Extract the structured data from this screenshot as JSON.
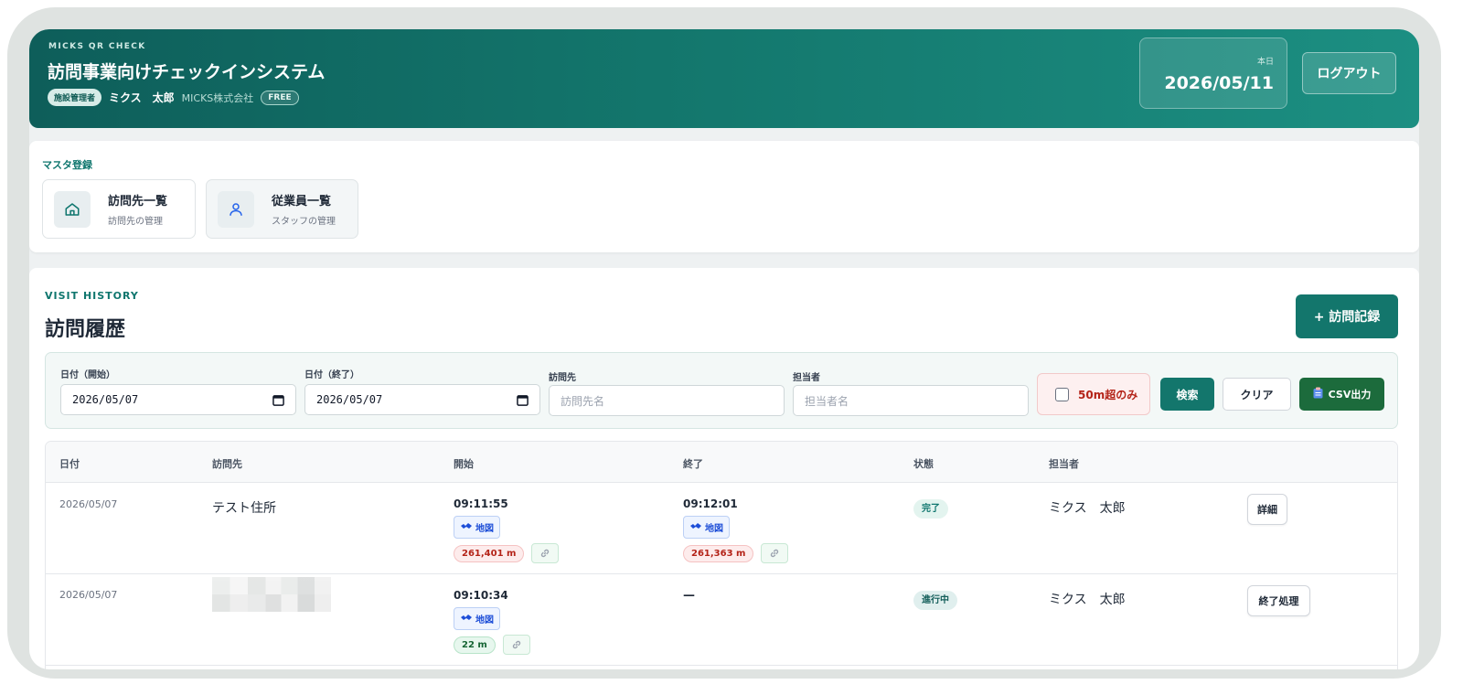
{
  "header": {
    "brand": "MICKS QR CHECK",
    "title": "訪問事業向けチェックインシステム",
    "role": "施設管理者",
    "user_name": "ミクス　太郎",
    "company": "MICKS株式会社",
    "plan": "FREE",
    "today_label": "本日",
    "today_value": "2026/05/11",
    "logout_label": "ログアウト"
  },
  "master": {
    "section_label": "マスタ登録",
    "cards": [
      {
        "title": "訪問先一覧",
        "subtitle": "訪問先の管理",
        "icon": "home-icon"
      },
      {
        "title": "従業員一覧",
        "subtitle": "スタッフの管理",
        "icon": "user-icon"
      }
    ]
  },
  "history": {
    "eyebrow": "VISIT HISTORY",
    "title": "訪問履歴",
    "add_label": "+ 訪問記録",
    "filter": {
      "date_start_label": "日付（開始）",
      "date_start_value": "2026/05/07",
      "date_end_label": "日付（終了）",
      "date_end_value": "2026/05/07",
      "place_label": "訪問先",
      "place_placeholder": "訪問先名",
      "staff_label": "担当者",
      "staff_placeholder": "担当者名",
      "over50_label": "50m超のみ",
      "search_label": "検索",
      "clear_label": "クリア",
      "csv_label": "CSV出力"
    },
    "columns": [
      "日付",
      "訪問先",
      "開始",
      "終了",
      "状態",
      "担当者"
    ],
    "rows": [
      {
        "date": "2026/05/07",
        "place": "テスト住所",
        "start_time": "09:11:55",
        "start_map": "地図",
        "start_distance": "261,401 m",
        "end_time": "09:12:01",
        "end_map": "地図",
        "end_distance": "261,363 m",
        "status": "完了",
        "staff": "ミクス　太郎",
        "action": "詳細"
      },
      {
        "date": "2026/05/07",
        "place": "",
        "start_time": "09:10:34",
        "start_map": "地図",
        "start_distance": "22 m",
        "end_time": "—",
        "status": "進行中",
        "staff": "ミクス　太郎",
        "action": "終了処理"
      }
    ]
  },
  "colors": {
    "primary": "#13766c",
    "header_dark": "#0e5e5a",
    "csv_green": "#1c6b3c",
    "danger": "#b42318"
  }
}
